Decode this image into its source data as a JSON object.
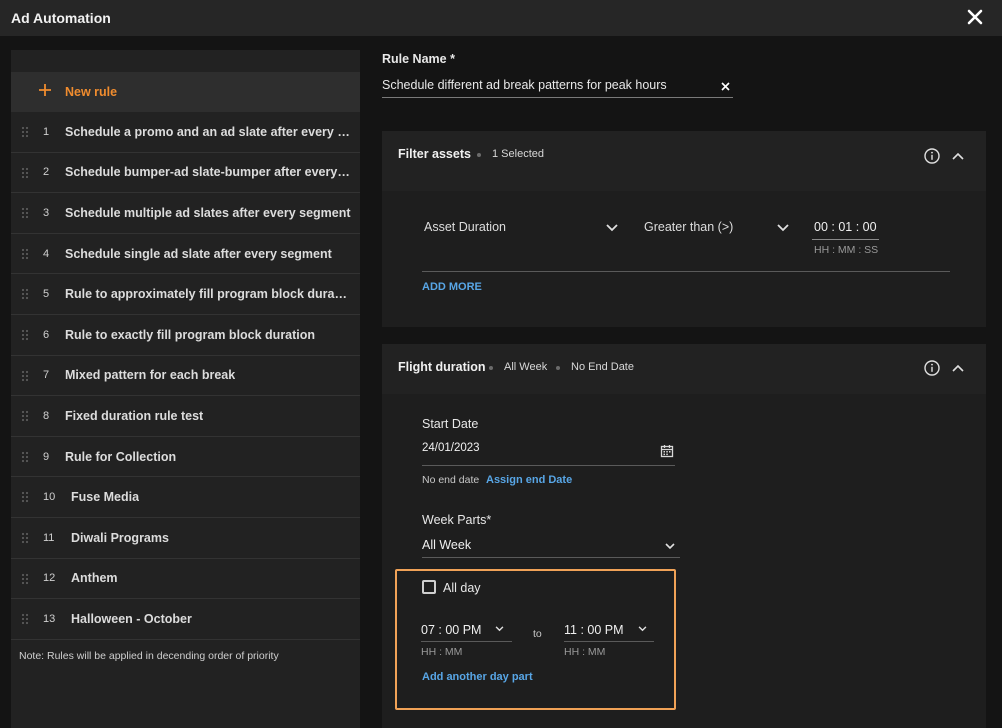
{
  "window": {
    "title": "Ad Automation"
  },
  "sidebar": {
    "new_rule_label": "New rule",
    "rules": [
      {
        "num": "1",
        "name": "Schedule a promo and an ad slate after every se..."
      },
      {
        "num": "2",
        "name": "Schedule bumper-ad slate-bumper after every se..."
      },
      {
        "num": "3",
        "name": "Schedule multiple ad slates after every segment"
      },
      {
        "num": "4",
        "name": "Schedule single ad slate after every segment"
      },
      {
        "num": "5",
        "name": "Rule to approximately fill program block duration"
      },
      {
        "num": "6",
        "name": "Rule to exactly fill program block duration"
      },
      {
        "num": "7",
        "name": "Mixed pattern for each break"
      },
      {
        "num": "8",
        "name": "Fixed duration rule test"
      },
      {
        "num": "9",
        "name": "Rule for Collection"
      },
      {
        "num": "10",
        "name": "Fuse Media"
      },
      {
        "num": "11",
        "name": "Diwali Programs"
      },
      {
        "num": "12",
        "name": "Anthem"
      },
      {
        "num": "13",
        "name": "Halloween - October"
      }
    ],
    "note": "Note: Rules will be applied in decending order of priority"
  },
  "rule_name": {
    "label": "Rule Name *",
    "value": "Schedule different ad break patterns for peak hours"
  },
  "filter_assets": {
    "title": "Filter assets",
    "selected": "1 Selected",
    "field": "Asset Duration",
    "operator": "Greater than (>)",
    "duration": "00 : 01 : 00",
    "duration_format": "HH : MM : SS",
    "add_more": "ADD MORE"
  },
  "flight_duration": {
    "title": "Flight duration",
    "week": "All Week",
    "end": "No End Date",
    "start_date_label": "Start Date",
    "start_date": "24/01/2023",
    "no_end_date": "No end date",
    "assign_end_date": "Assign end Date",
    "week_parts_label": "Week Parts*",
    "week_parts_value": "All Week",
    "all_day_label": "All day",
    "from_time": "07 : 00 PM",
    "to_label": "to",
    "to_time": "11 : 00 PM",
    "time_format": "HH : MM",
    "add_day_part": "Add another day part"
  },
  "colors": {
    "accent": "#f08c2e",
    "link": "#58a6e6",
    "highlight": "#f0a257"
  }
}
